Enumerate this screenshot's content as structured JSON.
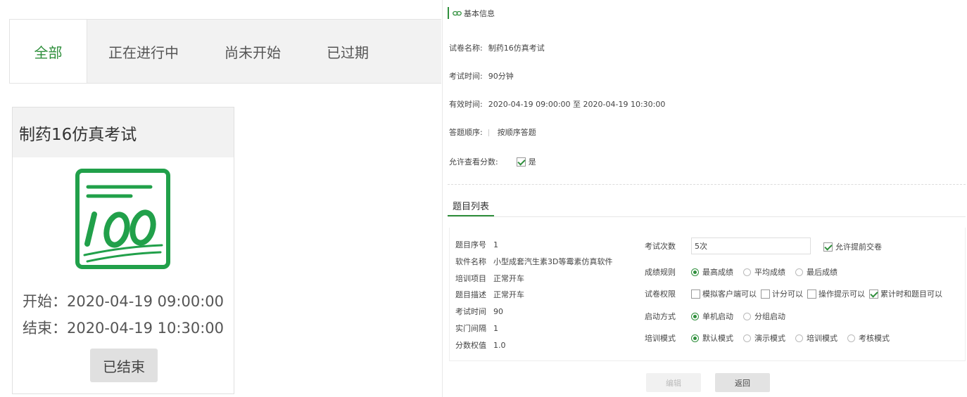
{
  "tabs": [
    {
      "label": "全部",
      "active": true
    },
    {
      "label": "正在进行中",
      "active": false
    },
    {
      "label": "尚未开始",
      "active": false
    },
    {
      "label": "已过期",
      "active": false
    }
  ],
  "exam_card": {
    "title": "制药16仿真考试",
    "icon": "score-100-icon",
    "start": "开始：2020-04-19 09:00:00",
    "end": "结束：2020-04-19 10:30:00",
    "status_button": "已结束"
  },
  "basic_info": {
    "section_title": "基本信息",
    "section_icon": "link-icon",
    "name_label": "试卷名称:",
    "name_value": "制药16仿真考试",
    "duration_label": "考试时间:",
    "duration_value": "90分钟",
    "valid_label": "有效时间:",
    "valid_value": "2020-04-19 09:00:00 至 2020-04-19 10:30:00",
    "order_label": "答题顺序:",
    "order_value": "按顺序答题",
    "allow_label": "允许查看分数:",
    "allow_value": "是",
    "allow_checked": true
  },
  "question_list": {
    "tab_label": "题目列表",
    "left": [
      {
        "key": "题目序号",
        "value": "1"
      },
      {
        "key": "软件名称",
        "value": "小型成套汽生素3D等霉素仿真软件"
      },
      {
        "key": "培训项目",
        "value": "正常开车"
      },
      {
        "key": "题目描述",
        "value": "正常开车"
      },
      {
        "key": "考试时间",
        "value": "90"
      },
      {
        "key": "实门间隔",
        "value": "1"
      },
      {
        "key": "分数权值",
        "value": "1.0"
      }
    ],
    "exam_count_label": "考试次数",
    "exam_count_value": "5次",
    "early_submit_label": "允许提前交卷",
    "early_submit_checked": true,
    "score_rule": {
      "label": "成绩规则",
      "options": [
        "最高成绩",
        "平均成绩",
        "最后成绩"
      ],
      "selected": 0
    },
    "permissions": {
      "label": "试卷权限",
      "options": [
        {
          "text": "模拟客户端可以",
          "checked": false
        },
        {
          "text": "计分可以",
          "checked": false
        },
        {
          "text": "操作提示可以",
          "checked": false
        },
        {
          "text": "累计时和题目可以",
          "checked": true
        }
      ]
    },
    "start_mode": {
      "label": "启动方式",
      "options": [
        "单机启动",
        "分组启动"
      ],
      "selected": 0
    },
    "train_mode": {
      "label": "培训模式",
      "options": [
        "默认模式",
        "演示模式",
        "培训模式",
        "考核模式"
      ],
      "selected": 0
    }
  },
  "buttons": {
    "edit": "编辑",
    "back": "返回"
  },
  "colors": {
    "accent": "#2f8f3c"
  }
}
